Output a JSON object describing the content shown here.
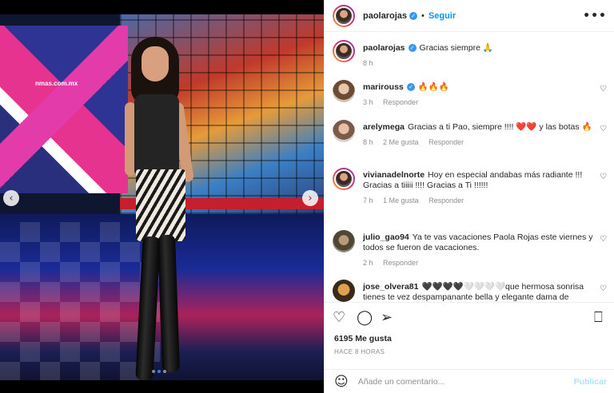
{
  "media": {
    "screen_text": "nmas.com.mx",
    "carousel_count": 3,
    "carousel_active_index": 1,
    "prev_icon": "chevron-left-icon",
    "next_icon": "chevron-right-icon"
  },
  "header": {
    "username": "paolarojas",
    "separator": "•",
    "follow_label": "Seguir",
    "more_icon": "more-horizontal-icon"
  },
  "caption": {
    "username": "paolarojas",
    "text": "Gracias siempre 🙏",
    "time": "8 h"
  },
  "comments": [
    {
      "user": "marirouss",
      "verified": true,
      "text": "🔥🔥🔥",
      "time": "3 h",
      "likes": "",
      "reply": "Responder"
    },
    {
      "user": "arelymega",
      "verified": false,
      "text": "Gracias a ti Pao, siempre !!!! ❤️❤️ y las botas 🔥",
      "time": "8 h",
      "likes": "2 Me gusta",
      "reply": "Responder"
    },
    {
      "user": "vivianadelnorte",
      "verified": false,
      "text": "Hoy en especial andabas más radiante !!! Gracias a tiiiii !!!! Gracias a Ti !!!!!!",
      "time": "7 h",
      "likes": "1 Me gusta",
      "reply": "Responder"
    },
    {
      "user": "julio_gao94",
      "verified": false,
      "text": "Ya te vas vacaciones Paola Rojas este viernes y todos se fueron de vacaciones.",
      "time": "2 h",
      "likes": "",
      "reply": "Responder"
    },
    {
      "user": "jose_olvera81",
      "verified": false,
      "text": "🖤🖤🖤🖤🤍🤍🤍🤍que hermosa sonrisa tienes te vez despampanante bella y elegante dama de",
      "time": "",
      "likes": "",
      "reply": ""
    }
  ],
  "actions": {
    "like_icon": "heart-icon",
    "comment_icon": "comment-icon",
    "share_icon": "send-icon",
    "save_icon": "bookmark-icon"
  },
  "likes_text": "6195 Me gusta",
  "post_time": "HACE 8 HORAS",
  "add_comment": {
    "placeholder": "Añade un comentario...",
    "publish_label": "Publicar",
    "emoji_icon": "emoji-icon"
  },
  "colors": {
    "link_blue": "#0095f6",
    "publish_disabled": "#b2dffc",
    "verified_blue": "#3897f0",
    "muted_text": "#8e8e8e"
  }
}
